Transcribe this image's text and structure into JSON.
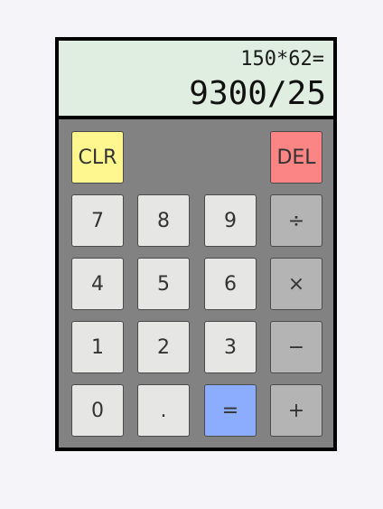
{
  "display": {
    "expression": "150*62=",
    "result": "9300/25"
  },
  "keys": {
    "clr": "CLR",
    "del": "DEL",
    "seven": "7",
    "eight": "8",
    "nine": "9",
    "divide": "÷",
    "four": "4",
    "five": "5",
    "six": "6",
    "multiply": "×",
    "one": "1",
    "two": "2",
    "three": "3",
    "minus": "−",
    "zero": "0",
    "dot": ".",
    "equals": "=",
    "plus": "+"
  },
  "colors": {
    "display_bg": "#dfeee1",
    "keypad_bg": "#828282",
    "digit_key": "#e6e6e4",
    "operator_key": "#b4b4b4",
    "clear_key": "#fef68e",
    "delete_key": "#fb8585",
    "equals_key": "#8cacfe"
  }
}
